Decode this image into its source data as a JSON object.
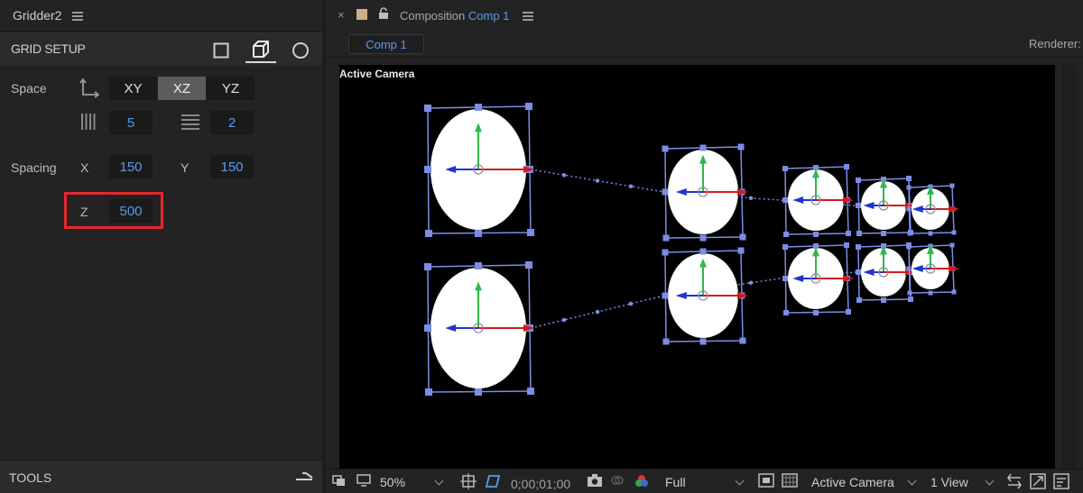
{
  "left_panel": {
    "tab_title": "Gridder2",
    "section_title": "GRID SETUP",
    "modes": [
      "square-mode-icon",
      "cube-mode-icon",
      "circle-mode-icon"
    ],
    "space": {
      "label": "Space",
      "options": [
        "XY",
        "XZ",
        "YZ"
      ],
      "selected": "XZ"
    },
    "columns": "5",
    "rows": "2",
    "spacing": {
      "label": "Spacing",
      "x_label": "X",
      "x_value": "150",
      "y_label": "Y",
      "y_value": "150",
      "z_label": "Z",
      "z_value": "500"
    },
    "tools_title": "TOOLS",
    "highlight_color": "#e6282c"
  },
  "composition": {
    "tab_prefix": "Composition",
    "comp_name": "Comp 1",
    "comp_button": "Comp 1",
    "renderer_label": "Renderer:",
    "viewer_label": "Active Camera"
  },
  "toolbar": {
    "zoom": "50%",
    "timecode": "0;00;01;00",
    "resolution": "Full",
    "camera": "Active Camera",
    "views": "1 View"
  },
  "colors": {
    "accent_blue": "#5a9bef",
    "panel_bg": "#232323",
    "viewer_bg": "#000000",
    "selection_box": "#7b8de6"
  }
}
